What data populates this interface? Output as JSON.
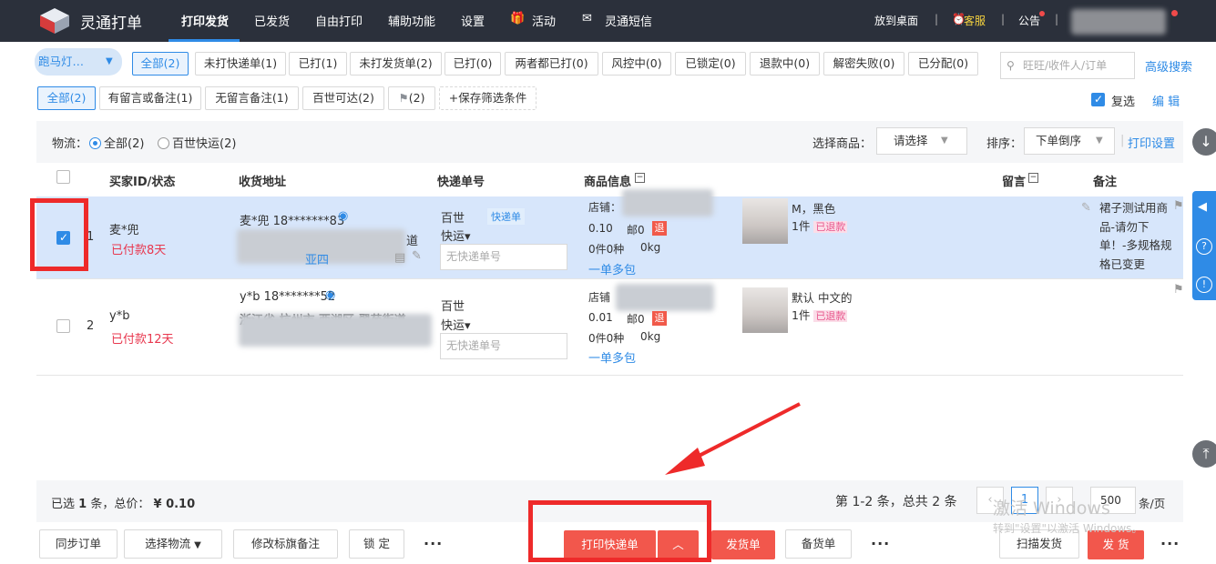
{
  "app": {
    "brand": "灵通打单"
  },
  "nav": {
    "items": [
      "打印发货",
      "已发货",
      "自由打印",
      "辅助功能",
      "设置",
      "活动",
      "灵通短信"
    ],
    "right": [
      "放到桌面",
      "客服",
      "公告"
    ]
  },
  "filters": {
    "shop": "跑马灯…",
    "status_tabs": [
      "全部(2)",
      "未打快递单(1)",
      "已打(1)",
      "未打发货单(2)",
      "已打(0)",
      "两者都已打(0)",
      "风控中(0)",
      "已锁定(0)",
      "退款中(0)",
      "解密失败(0)",
      "已分配(0)"
    ],
    "search_placeholder": "旺旺/收件人/订单",
    "advanced_search": "高级搜索",
    "note_tabs": [
      "全部(2)",
      "有留言或备注(1)",
      "无留言备注(1)",
      "百世可达(2)",
      "(2)",
      "+保存筛选条件"
    ],
    "reselect": "复选",
    "edit": "编 辑"
  },
  "logistics": {
    "label": "物流：",
    "options": [
      "全部(2)",
      "百世快运(2)"
    ],
    "select_goods_label": "选择商品：",
    "select_goods_value": "请选择",
    "sort_label": "排序：",
    "sort_value": "下单倒序",
    "print_settings": "打印设置"
  },
  "table": {
    "headers": [
      "买家ID/状态",
      "收货地址",
      "快递单号",
      "商品信息",
      "留言",
      "备注"
    ],
    "rows": [
      {
        "index": "1",
        "buyer": "麦*兜",
        "status": "已付款8天",
        "address_line1": "麦*兜 18*******83",
        "address_frag1": "道",
        "address_frag2": "亚四",
        "courier_line1": "百世",
        "courier_line2": "快运▾",
        "courier_tag": "快递单",
        "tracking_placeholder": "无快递单号",
        "shop_label": "店铺：",
        "price": "0.10",
        "post": "邮0",
        "refund": "退",
        "qty": "0件0种",
        "weight": "0kg",
        "multi": "一单多包",
        "sku": "M，黑色",
        "count": "1件",
        "refund_status": "已退款",
        "remark": "裙子测试用商品-请勿下单！-多规格规格已变更"
      },
      {
        "index": "2",
        "buyer": "y*b",
        "status": "已付款12天",
        "address_line1": "y*b 18*******52",
        "address_line2": "浙江省 杭州市 西湖区 翠苑街道",
        "courier_line1": "百世",
        "courier_line2": "快运▾",
        "tracking_placeholder": "无快递单号",
        "shop_label": "店铺",
        "price": "0.01",
        "post": "邮0",
        "refund": "退",
        "qty": "0件0种",
        "weight": "0kg",
        "multi": "一单多包",
        "sku": "默认 中文的",
        "count": "1件",
        "refund_status": "已退款"
      }
    ]
  },
  "summary": {
    "selected_prefix": "已选",
    "selected_count": "1",
    "selected_suffix": "条，总价：",
    "total": "¥ 0.10",
    "page_info": "第 1-2 条，总共 2 条",
    "page": "1",
    "page_size": "500",
    "per_page": "条/页"
  },
  "actions": {
    "sync": "同步订单",
    "choose_logistics": "选择物流",
    "modify_flag": "修改标旗备注",
    "lock": "锁 定",
    "more": "···",
    "print_express": "打印快递单",
    "shipping_list": "发货单",
    "picking_list": "备货单",
    "scan_ship": "扫描发货",
    "ship": "发 货"
  },
  "watermark": {
    "line1": "激活 Windows",
    "line2": "转到\"设置\"以激活 Windows。"
  },
  "colors": {
    "accent": "#2f8be6",
    "nav_bg": "#2b303b",
    "danger": "#f2574c",
    "annotation": "#ee2a2a"
  }
}
